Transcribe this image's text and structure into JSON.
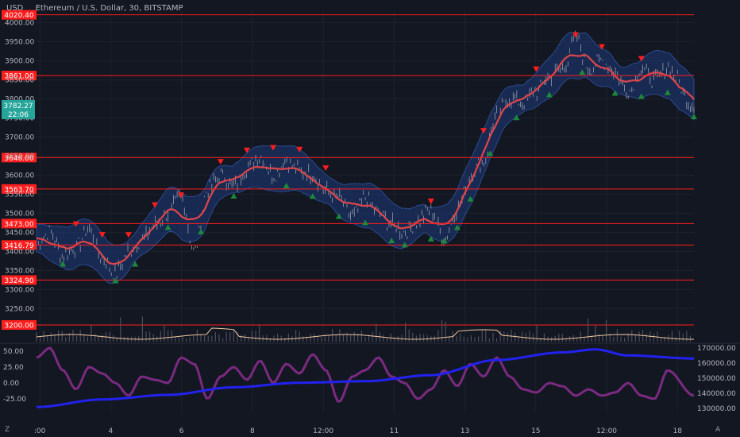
{
  "header": {
    "currency": "USD",
    "title": "Ethereum / U.S. Dollar, 30, BITSTAMP"
  },
  "corner_left": "Z",
  "corner_right": "A",
  "colors": {
    "background": "#131722",
    "text": "#b2b5be",
    "level_line": "#ff1e1e",
    "level_label_bg": "#ff1e1e",
    "price_line": "#b9b9c3",
    "ma_line": "#e0454a",
    "band_fill": "#1d3a78",
    "marker_up": "#1b8a3a",
    "marker_down": "#ff1e1e",
    "price_tag_bg": "#26a69a",
    "volume_line": "#f0c8a0",
    "oscillator": "#7a2a80",
    "cumulative": "#2222ee"
  },
  "chart_data": [
    {
      "type": "line",
      "name": "price",
      "ylim": [
        3230,
        4030
      ],
      "y_ticks": [
        "4000.00",
        "3950.00",
        "3900.00",
        "3850.00",
        "3800.00",
        "3750.00",
        "3700.00",
        "3650.00",
        "3600.00",
        "3550.00",
        "3500.00",
        "3450.00",
        "3400.00",
        "3350.00",
        "3300.00",
        "3250.00"
      ],
      "x_ticks": [
        ":00",
        "4",
        "6",
        "8",
        "12:00",
        "11",
        "13",
        "15",
        "12:00",
        "18"
      ],
      "levels": [
        "4020.40",
        "3861.00",
        "3646.00",
        "3563.70",
        "3473.00",
        "3416.79",
        "3324.90",
        "3200.00"
      ],
      "last_price": "3782.27",
      "countdown": "22:06",
      "series_keypoints": [
        [
          0,
          3420
        ],
        [
          0.02,
          3450
        ],
        [
          0.04,
          3390
        ],
        [
          0.06,
          3410
        ],
        [
          0.08,
          3460
        ],
        [
          0.1,
          3380
        ],
        [
          0.12,
          3340
        ],
        [
          0.14,
          3400
        ],
        [
          0.16,
          3430
        ],
        [
          0.18,
          3470
        ],
        [
          0.2,
          3500
        ],
        [
          0.22,
          3545
        ],
        [
          0.24,
          3400
        ],
        [
          0.26,
          3560
        ],
        [
          0.28,
          3600
        ],
        [
          0.3,
          3570
        ],
        [
          0.32,
          3620
        ],
        [
          0.34,
          3650
        ],
        [
          0.36,
          3600
        ],
        [
          0.38,
          3640
        ],
        [
          0.4,
          3610
        ],
        [
          0.42,
          3600
        ],
        [
          0.44,
          3560
        ],
        [
          0.46,
          3540
        ],
        [
          0.48,
          3490
        ],
        [
          0.5,
          3540
        ],
        [
          0.52,
          3500
        ],
        [
          0.54,
          3470
        ],
        [
          0.56,
          3450
        ],
        [
          0.58,
          3480
        ],
        [
          0.6,
          3510
        ],
        [
          0.62,
          3430
        ],
        [
          0.64,
          3510
        ],
        [
          0.66,
          3600
        ],
        [
          0.68,
          3640
        ],
        [
          0.7,
          3760
        ],
        [
          0.72,
          3800
        ],
        [
          0.74,
          3790
        ],
        [
          0.76,
          3820
        ],
        [
          0.78,
          3860
        ],
        [
          0.8,
          3880
        ],
        [
          0.82,
          3960
        ],
        [
          0.84,
          3880
        ],
        [
          0.86,
          3900
        ],
        [
          0.88,
          3870
        ],
        [
          0.9,
          3820
        ],
        [
          0.92,
          3880
        ],
        [
          0.94,
          3850
        ],
        [
          0.96,
          3880
        ],
        [
          1.0,
          3782
        ]
      ],
      "up_markers": [
        0.04,
        0.12,
        0.15,
        0.2,
        0.25,
        0.3,
        0.38,
        0.42,
        0.46,
        0.5,
        0.54,
        0.56,
        0.6,
        0.62,
        0.64,
        0.66,
        0.69,
        0.73,
        0.78,
        0.83,
        0.88,
        0.92,
        0.96,
        1.0
      ],
      "down_markers": [
        0.06,
        0.1,
        0.14,
        0.18,
        0.22,
        0.28,
        0.32,
        0.36,
        0.4,
        0.44,
        0.6,
        0.68,
        0.76,
        0.82,
        0.86,
        0.92
      ]
    },
    {
      "type": "line",
      "name": "volume",
      "ylim": [
        0,
        1
      ]
    },
    {
      "type": "line",
      "name": "indicator",
      "left_ticks": [
        "50.00",
        "25.00",
        "0.00",
        "-25.00"
      ],
      "left_ylim": [
        -45,
        60
      ],
      "right_ticks": [
        "170000.00",
        "160000.00",
        "150000.00",
        "140000.00",
        "130000.00"
      ],
      "right_ylim": [
        128000,
        172000
      ],
      "oscillator_keypoints": [
        [
          0,
          40
        ],
        [
          0.02,
          55
        ],
        [
          0.04,
          20
        ],
        [
          0.06,
          -10
        ],
        [
          0.08,
          25
        ],
        [
          0.1,
          15
        ],
        [
          0.12,
          0
        ],
        [
          0.14,
          -20
        ],
        [
          0.16,
          10
        ],
        [
          0.18,
          5
        ],
        [
          0.2,
          0
        ],
        [
          0.22,
          40
        ],
        [
          0.24,
          30
        ],
        [
          0.26,
          -25
        ],
        [
          0.28,
          10
        ],
        [
          0.3,
          25
        ],
        [
          0.32,
          5
        ],
        [
          0.34,
          35
        ],
        [
          0.36,
          0
        ],
        [
          0.38,
          30
        ],
        [
          0.4,
          15
        ],
        [
          0.42,
          45
        ],
        [
          0.44,
          20
        ],
        [
          0.46,
          -30
        ],
        [
          0.48,
          10
        ],
        [
          0.5,
          20
        ],
        [
          0.52,
          40
        ],
        [
          0.54,
          10
        ],
        [
          0.56,
          0
        ],
        [
          0.58,
          -25
        ],
        [
          0.6,
          -10
        ],
        [
          0.62,
          20
        ],
        [
          0.64,
          -5
        ],
        [
          0.66,
          30
        ],
        [
          0.68,
          10
        ],
        [
          0.7,
          40
        ],
        [
          0.72,
          10
        ],
        [
          0.74,
          -10
        ],
        [
          0.76,
          -15
        ],
        [
          0.78,
          0
        ],
        [
          0.8,
          -5
        ],
        [
          0.82,
          -20
        ],
        [
          0.84,
          -10
        ],
        [
          0.86,
          -20
        ],
        [
          0.88,
          -15
        ],
        [
          0.9,
          0
        ],
        [
          0.92,
          -20
        ],
        [
          0.94,
          -25
        ],
        [
          0.96,
          20
        ],
        [
          1.0,
          -20
        ]
      ],
      "cumulative_keypoints": [
        [
          0,
          131000
        ],
        [
          0.1,
          136000
        ],
        [
          0.2,
          139000
        ],
        [
          0.3,
          144000
        ],
        [
          0.4,
          147000
        ],
        [
          0.5,
          148000
        ],
        [
          0.6,
          152000
        ],
        [
          0.7,
          162000
        ],
        [
          0.8,
          167000
        ],
        [
          0.85,
          169000
        ],
        [
          0.9,
          165000
        ],
        [
          1.0,
          163000
        ]
      ]
    }
  ]
}
